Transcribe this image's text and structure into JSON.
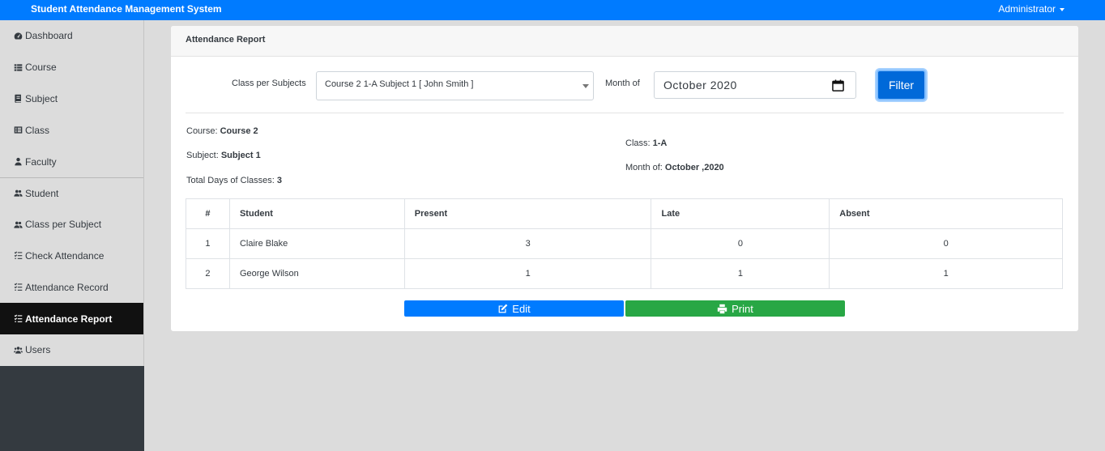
{
  "app": {
    "title": "Student Attendance Management System",
    "user_menu": "Administrator"
  },
  "sidebar": {
    "items": [
      {
        "label": "Dashboard",
        "icon": "tachometer-icon"
      },
      {
        "label": "Course",
        "icon": "list-icon"
      },
      {
        "label": "Subject",
        "icon": "book-icon"
      },
      {
        "label": "Class",
        "icon": "list-alt-icon"
      },
      {
        "label": "Faculty",
        "icon": "user-tie-icon"
      },
      {
        "label": "Student",
        "icon": "users-icon"
      },
      {
        "label": "Class per Subject",
        "icon": "users-icon"
      },
      {
        "label": "Check Attendance",
        "icon": "tasks-icon"
      },
      {
        "label": "Attendance Record",
        "icon": "tasks-icon"
      },
      {
        "label": "Attendance Report",
        "icon": "tasks-icon",
        "active": true
      },
      {
        "label": "Users",
        "icon": "users-cog-icon"
      }
    ]
  },
  "report": {
    "title": "Attendance Report",
    "filter": {
      "class_label": "Class per Subjects",
      "class_value": "Course 2 1-A Subject 1 [ John Smith ]",
      "month_label": "Month of",
      "month_value": "October 2020",
      "filter_button": "Filter"
    },
    "info": {
      "course_label": "Course:",
      "course_value": "Course 2",
      "subject_label": "Subject:",
      "subject_value": "Subject 1",
      "total_label": "Total Days of Classes:",
      "total_value": "3",
      "class_label": "Class:",
      "class_value": "1-A",
      "month_label": "Month of:",
      "month_value": "October ,2020"
    },
    "table": {
      "headers": [
        "#",
        "Student",
        "Present",
        "Late",
        "Absent"
      ],
      "rows": [
        [
          "1",
          "Claire Blake",
          "3",
          "0",
          "0"
        ],
        [
          "2",
          "George Wilson",
          "1",
          "1",
          "1"
        ]
      ]
    },
    "buttons": {
      "edit": "Edit",
      "print": "Print"
    }
  },
  "colors": {
    "navbar": "#007bff",
    "edit_button": "#007bff",
    "print_button": "#28a745",
    "active_sidebar": "#111111"
  }
}
